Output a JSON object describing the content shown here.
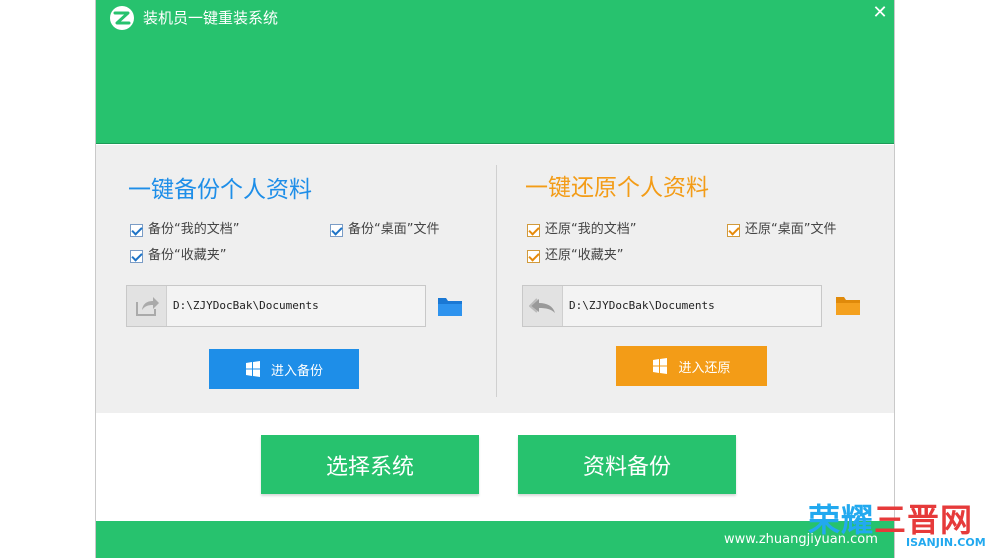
{
  "app": {
    "title": "装机员一键重装系统",
    "close_symbol": "✕"
  },
  "backup": {
    "title": "一键备份个人资料",
    "options": [
      {
        "label": "备份“我的文档”",
        "checked": true
      },
      {
        "label": "备份“桌面”文件",
        "checked": true
      },
      {
        "label": "备份“收藏夹”",
        "checked": true
      }
    ],
    "path": "D:\\ZJYDocBak\\Documents",
    "button_label": "进入备份",
    "accent": "#1e8ee8"
  },
  "restore": {
    "title": "一键还原个人资料",
    "options": [
      {
        "label": "还原“我的文档”",
        "checked": true
      },
      {
        "label": "还原“桌面”文件",
        "checked": true
      },
      {
        "label": "还原“收藏夹”",
        "checked": true
      }
    ],
    "path": "D:\\ZJYDocBak\\Documents",
    "button_label": "进入还原",
    "accent": "#f39c17"
  },
  "bottom_buttons": {
    "select_system": "选择系统",
    "data_backup": "资料备份"
  },
  "footer": {
    "url": "www.zhuangjiyuan.com"
  },
  "watermark": {
    "main_blue": "荣耀",
    "main_red": "三晋网",
    "sub": "ISANJIN.COM"
  },
  "colors": {
    "brand_green": "#27c26e",
    "panel_gray": "#efefef"
  },
  "icons": [
    "app-logo-icon",
    "close-icon",
    "checkbox-icon",
    "share-icon",
    "undo-icon",
    "folder-icon",
    "windows-icon"
  ]
}
